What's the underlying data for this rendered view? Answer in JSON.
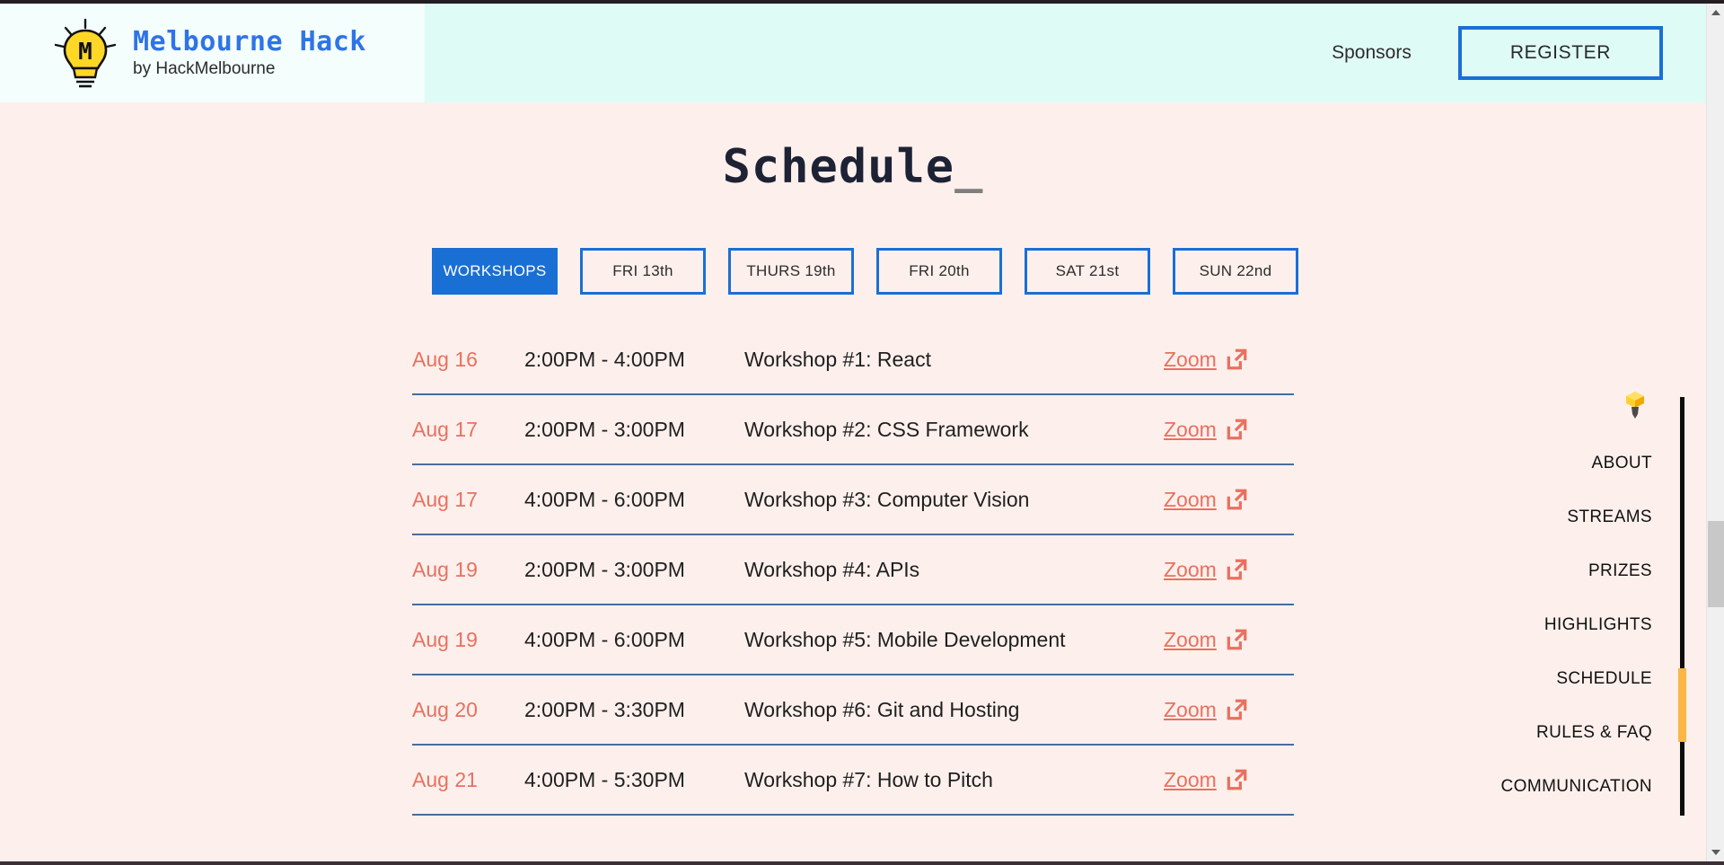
{
  "header": {
    "brand_title": "Melbourne Hack",
    "brand_sub": "by HackMelbourne",
    "logo_icon": "lightbulb-m-icon",
    "sponsors_label": "Sponsors",
    "register_label": "REGISTER",
    "brand_color": "#2f73e8",
    "bg_color": "#dffbf5",
    "panel_color": "#f4fefc"
  },
  "main": {
    "title": "Schedule",
    "title_caret": "_",
    "tabs": [
      {
        "label": "WORKSHOPS",
        "active": true
      },
      {
        "label": "FRI 13th",
        "active": false
      },
      {
        "label": "THURS 19th",
        "active": false
      },
      {
        "label": "FRI 20th",
        "active": false
      },
      {
        "label": "SAT 21st",
        "active": false
      },
      {
        "label": "SUN 22nd",
        "active": false
      }
    ],
    "link_label": "Zoom",
    "link_icon": "external-link-icon",
    "rows": [
      {
        "date": "Aug 16",
        "time": "2:00PM - 4:00PM",
        "name": "Workshop #1: React"
      },
      {
        "date": "Aug 17",
        "time": "2:00PM - 3:00PM",
        "name": "Workshop #2: CSS Framework"
      },
      {
        "date": "Aug 17",
        "time": "4:00PM - 6:00PM",
        "name": "Workshop #3: Computer Vision"
      },
      {
        "date": "Aug 19",
        "time": "2:00PM - 3:00PM",
        "name": "Workshop #4: APIs"
      },
      {
        "date": "Aug 19",
        "time": "4:00PM - 6:00PM",
        "name": "Workshop #5: Mobile Development"
      },
      {
        "date": "Aug 20",
        "time": "2:00PM - 3:30PM",
        "name": "Workshop #6: Git and Hosting"
      },
      {
        "date": "Aug 21",
        "time": "4:00PM - 5:30PM",
        "name": "Workshop #7: How to Pitch"
      }
    ],
    "accent_color": "#e9705f",
    "tab_color": "#1a6fd4",
    "bg_color": "#fdf0ec"
  },
  "side_nav": {
    "bulb_icon": "lightbulb-marker-icon",
    "active": "SCHEDULE",
    "marker_color": "#fbb745",
    "items": [
      {
        "label": "ABOUT"
      },
      {
        "label": "STREAMS"
      },
      {
        "label": "PRIZES"
      },
      {
        "label": "HIGHLIGHTS"
      },
      {
        "label": "SCHEDULE"
      },
      {
        "label": "RULES & FAQ"
      },
      {
        "label": "COMMUNICATION"
      }
    ]
  },
  "scrollbar": {
    "up_icon": "scroll-up-arrow-icon",
    "down_icon": "scroll-down-arrow-icon"
  }
}
